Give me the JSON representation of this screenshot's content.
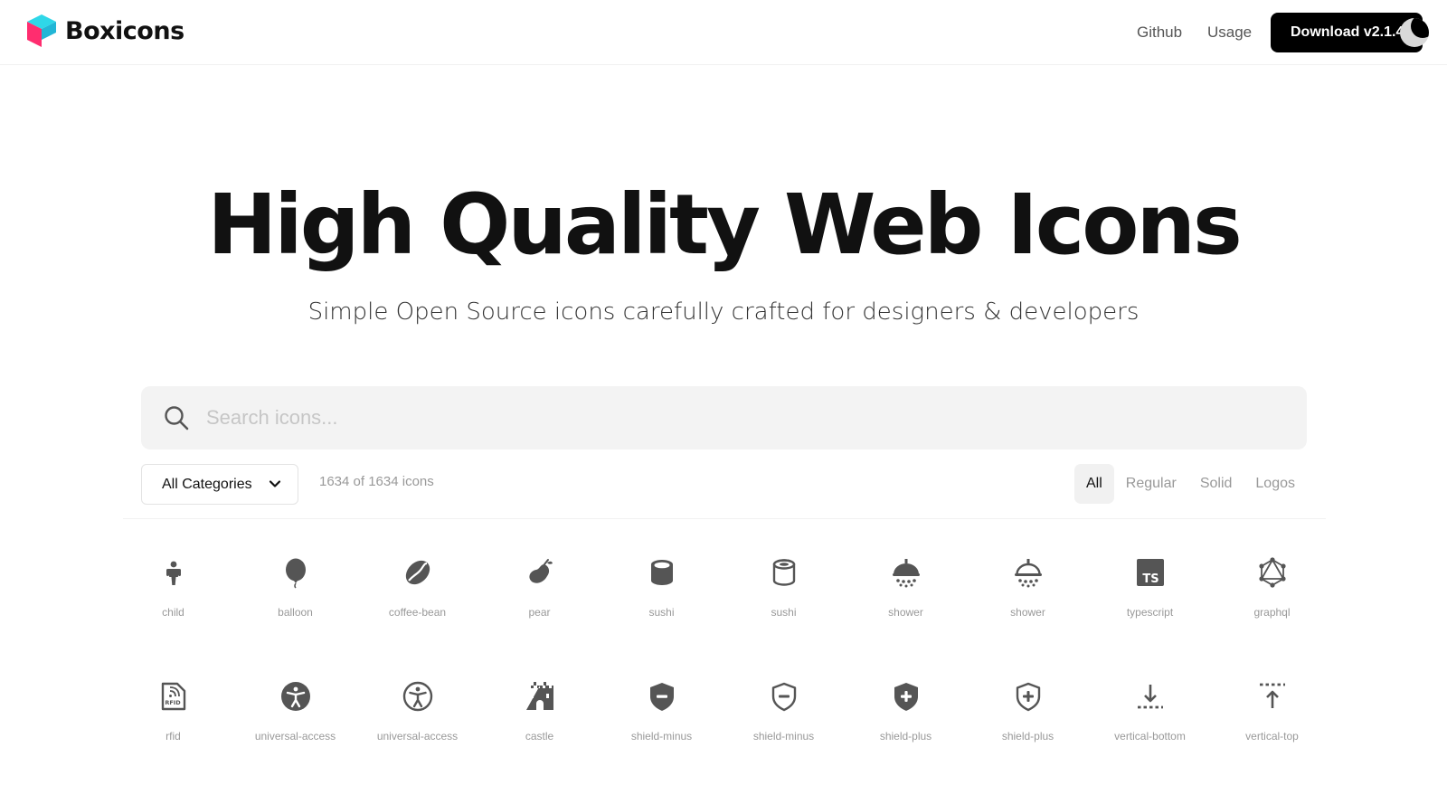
{
  "header": {
    "brand": "Boxicons",
    "nav": [
      {
        "label": "Github"
      },
      {
        "label": "Usage"
      }
    ],
    "download_label": "Download v2.1.4"
  },
  "hero": {
    "title": "High Quality Web Icons",
    "subtitle": "Simple Open Source icons carefully crafted for designers & developers"
  },
  "search": {
    "placeholder": "Search icons...",
    "value": ""
  },
  "filters": {
    "category_label": "All Categories",
    "count_text": "1634 of 1634 icons",
    "tabs": [
      {
        "label": "All",
        "active": true
      },
      {
        "label": "Regular",
        "active": false
      },
      {
        "label": "Solid",
        "active": false
      },
      {
        "label": "Logos",
        "active": false
      }
    ]
  },
  "icons": [
    {
      "label": "child",
      "icon": "child-icon"
    },
    {
      "label": "balloon",
      "icon": "balloon-icon"
    },
    {
      "label": "coffee-bean",
      "icon": "coffee-bean-icon"
    },
    {
      "label": "pear",
      "icon": "pear-icon"
    },
    {
      "label": "sushi",
      "icon": "sushi-solid-icon"
    },
    {
      "label": "sushi",
      "icon": "sushi-regular-icon"
    },
    {
      "label": "shower",
      "icon": "shower-solid-icon"
    },
    {
      "label": "shower",
      "icon": "shower-regular-icon"
    },
    {
      "label": "typescript",
      "icon": "typescript-icon"
    },
    {
      "label": "graphql",
      "icon": "graphql-icon"
    },
    {
      "label": "rfid",
      "icon": "rfid-icon"
    },
    {
      "label": "universal-access",
      "icon": "universal-access-solid-icon"
    },
    {
      "label": "universal-access",
      "icon": "universal-access-regular-icon"
    },
    {
      "label": "castle",
      "icon": "castle-icon"
    },
    {
      "label": "shield-minus",
      "icon": "shield-minus-solid-icon"
    },
    {
      "label": "shield-minus",
      "icon": "shield-minus-regular-icon"
    },
    {
      "label": "shield-plus",
      "icon": "shield-plus-solid-icon"
    },
    {
      "label": "shield-plus",
      "icon": "shield-plus-regular-icon"
    },
    {
      "label": "vertical-bottom",
      "icon": "vertical-bottom-icon"
    },
    {
      "label": "vertical-top",
      "icon": "vertical-top-icon"
    }
  ],
  "colors": {
    "icon": "#555555",
    "logo_pink": "#ff2d6f",
    "logo_cyan": "#23d5e6",
    "button_bg": "#000000"
  }
}
